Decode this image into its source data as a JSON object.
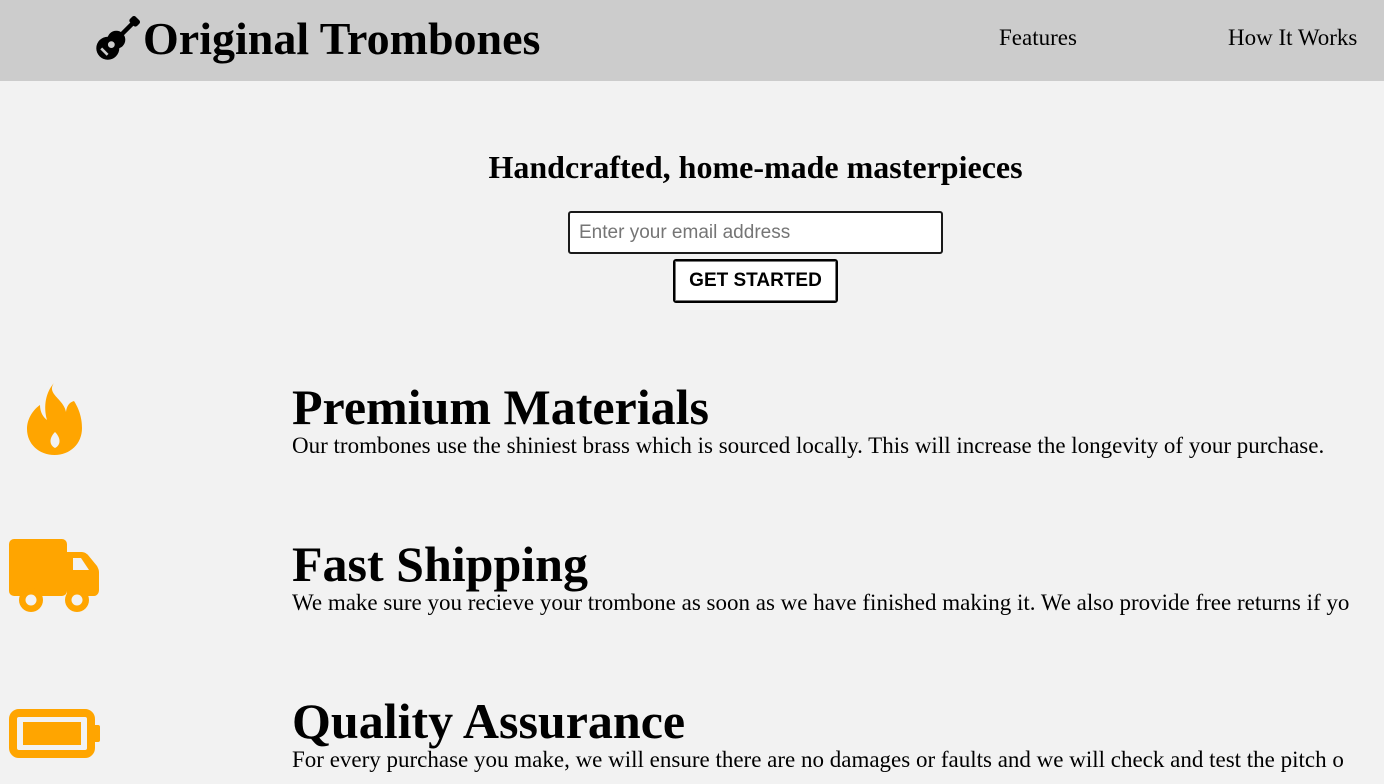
{
  "header": {
    "logo_icon": "guitar-icon",
    "brand": "Original Trombones",
    "nav": [
      {
        "label": "Features"
      },
      {
        "label": "How It Works"
      }
    ]
  },
  "hero": {
    "title": "Handcrafted, home-made masterpieces",
    "email_placeholder": "Enter your email address",
    "email_value": "",
    "button_label": "GET STARTED"
  },
  "features": [
    {
      "icon": "fire-icon",
      "title": "Premium Materials",
      "description": "Our trombones use the shiniest brass which is sourced locally. This will increase the longevity of your purchase."
    },
    {
      "icon": "truck-icon",
      "title": "Fast Shipping",
      "description": "We make sure you recieve your trombone as soon as we have finished making it. We also provide free returns if yo"
    },
    {
      "icon": "battery-icon",
      "title": "Quality Assurance",
      "description": "For every purchase you make, we will ensure there are no damages or faults and we will check and test the pitch o"
    }
  ],
  "colors": {
    "header_bg": "#cccccc",
    "page_bg": "#f2f2f2",
    "icon_accent": "#ffa500"
  }
}
